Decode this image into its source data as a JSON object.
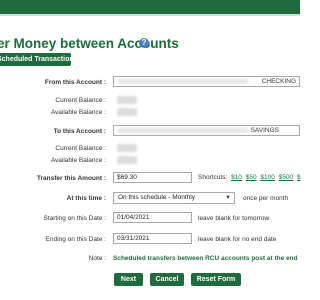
{
  "page": {
    "title": "er Money between Accounts",
    "scheduled_button": "Scheduled Transactions"
  },
  "form": {
    "from_label": "From this Account :",
    "from_account_type": "CHECKING",
    "current_balance_label": "Current Balance :",
    "available_balance_label": "Available Balance :",
    "to_label": "To this Account :",
    "to_account_type": "SAVINGS",
    "amount_label": "Transfer this Amount :",
    "amount_value": "$69.30",
    "shortcuts_label": "Shortcuts:",
    "shortcuts": [
      "$10",
      "$50",
      "$100",
      "$500",
      "$"
    ],
    "at_this_time_label": "At this time :",
    "schedule_value": "On this schedule - Monthly",
    "frequency_hint": "once per month",
    "start_label": "Starting on this Date :",
    "start_value": "01/04/2021",
    "start_hint": "leave blank for tomorrow",
    "end_label": "Ending on this Date :",
    "end_value": "03/31/2021",
    "end_hint": "leave blank for no end date",
    "note_label": "Note :",
    "note_text": "Scheduled transfers between RCU accounts post at the end"
  },
  "buttons": {
    "next": "Next",
    "cancel": "Cancel",
    "reset": "Reset Form"
  },
  "colors": {
    "brand_green": "#1f6b3d",
    "help_blue": "#4a7fc0"
  },
  "icons": {
    "help": "question-circle-icon",
    "dropdown": "chevron-down-icon"
  }
}
